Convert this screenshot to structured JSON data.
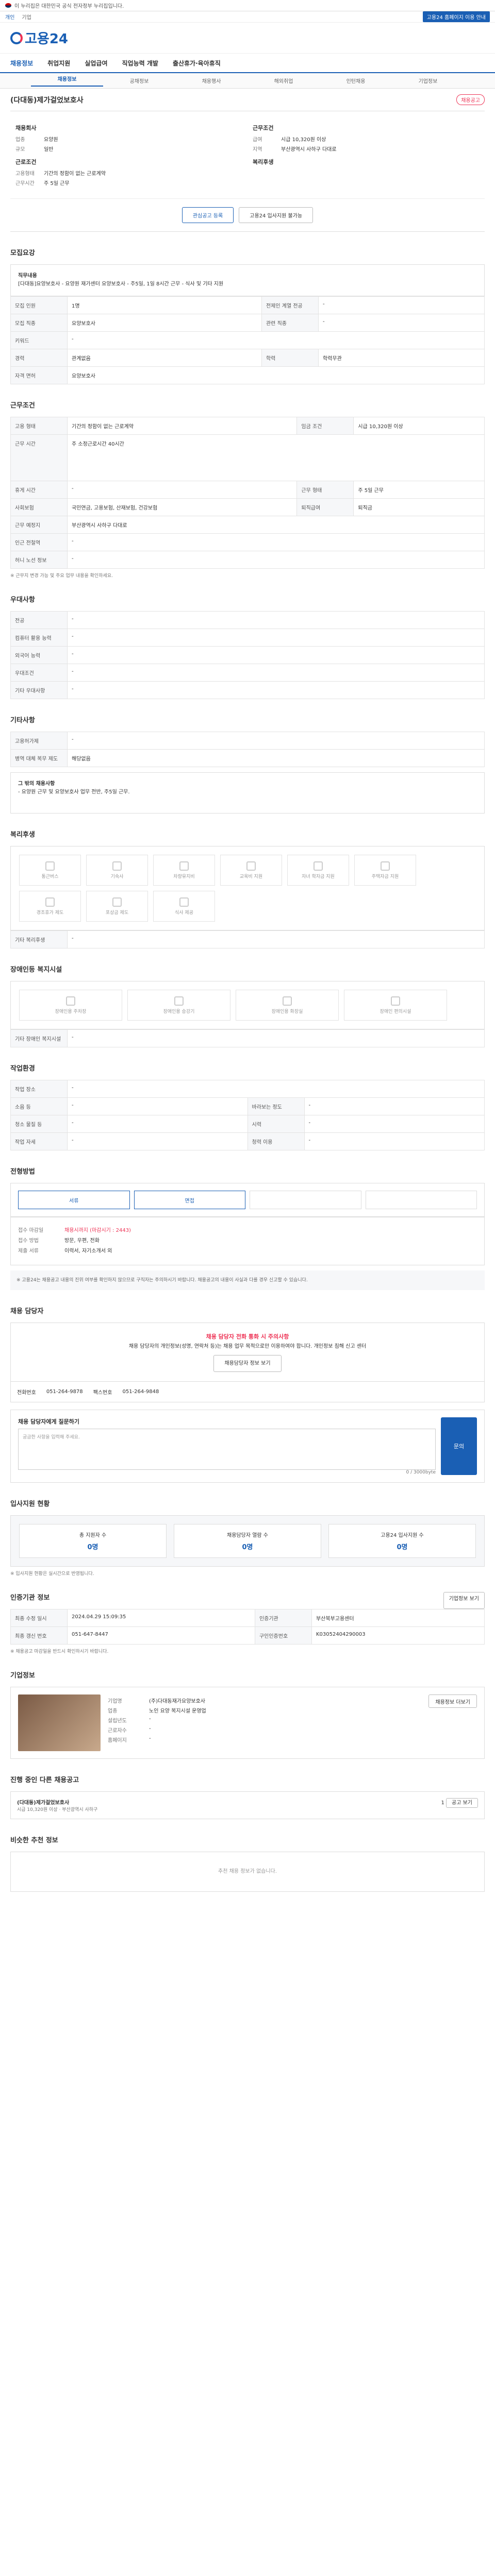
{
  "gov": {
    "text": "이 누리집은 대한민국 공식 전자정부 누리집입니다."
  },
  "top": {
    "home": "개인",
    "corp": "기업",
    "right": "고용24 홈페이지 이용 안내"
  },
  "logo": "고용24",
  "nav": [
    "채용정보",
    "취업지원",
    "실업급여",
    "직업능력 개발",
    "출산휴가·육아휴직"
  ],
  "subnav": [
    "채용정보",
    "공채정보",
    "채용행사",
    "해외취업",
    "인턴채용",
    "기업정보"
  ],
  "title": "(다대동)제가걸었보호사",
  "badge": "채용공고",
  "summary": {
    "left_h": "채용회사",
    "left": [
      [
        "업종",
        "요양원"
      ],
      [
        "규모",
        "일반"
      ]
    ],
    "left_h2": "근로조건",
    "left2": [
      [
        "고용형태",
        "기간의 정함이 없는 근로계약"
      ],
      [
        "근무시간",
        "주 5일 근무"
      ]
    ],
    "right_h": "근무조건",
    "right": [
      [
        "급여",
        "시급 10,320원 이상"
      ],
      [
        "지역",
        "부산광역시 사하구 다대로"
      ]
    ],
    "right_h2": "복리후생"
  },
  "buttons": {
    "apply": "관심공고 등록",
    "print": "고용24 입사지원 불가능"
  },
  "s1": {
    "h": "모집요강",
    "jobdesc_label": "직무내용",
    "jobdesc": "[다대동]요양보호사 - 요양원 재가센터 요양보호사 - 주5일, 1일 8시간 근무 - 식사 및 기타 지원",
    "rows": [
      [
        "모집 인원",
        "1명",
        "전제인 계열 전공",
        "-"
      ],
      [
        "모집 직종",
        "요양보호사",
        "관련 직종",
        "-"
      ],
      [
        "키워드",
        "-",
        "",
        ""
      ],
      [
        "경력",
        "관계없음",
        "학력",
        "학력무관"
      ],
      [
        "자격 면허",
        "요양보호사",
        "",
        ""
      ]
    ]
  },
  "s2": {
    "h": "근무조건",
    "rows": [
      [
        "고용 형태",
        "기간의 정함이 없는 근로계약",
        "임금 조건",
        "시급 10,320원 이상"
      ],
      [
        "근무 시간",
        "주 소정근로시간 40시간",
        "",
        ""
      ],
      [
        "휴게 시간",
        "-",
        "근무 형태",
        "주 5일 근무"
      ],
      [
        "사회보험",
        "국민연금, 고용보험, 산재보험, 건강보험",
        "퇴직급여",
        "퇴직금"
      ],
      [
        "근무 예정지",
        "부산광역시 사하구 다대로",
        "",
        ""
      ],
      [
        "인근 전철역",
        "-",
        "",
        ""
      ],
      [
        "허니 노선 정보",
        "-",
        "",
        ""
      ]
    ],
    "note": "※ 근무지 변경 가능 및 주요 업무 내용을 확인하세요."
  },
  "s3": {
    "h": "우대사항",
    "rows": [
      [
        "전공",
        "-"
      ],
      [
        "컴퓨터 활용 능력",
        "-"
      ],
      [
        "외국어 능력",
        "-"
      ],
      [
        "우대조건",
        "-"
      ],
      [
        "기타 우대사항",
        "-"
      ]
    ]
  },
  "s4": {
    "h": "기타사항",
    "rows": [
      [
        "고용허가제",
        "-"
      ],
      [
        "병역 대체 복무 제도",
        "해당없음"
      ]
    ],
    "extra_h": "그 밖의 채용사항",
    "extra": "- 요양원 근무 및 요양보호사 업무 전반, 주5일 근무."
  },
  "s5": {
    "h": "복리후생",
    "items": [
      "통근버스",
      "기숙사",
      "차량유지비",
      "교육비 지원",
      "자녀 학자금 지원",
      "주택자금 지원",
      "경조휴가 제도",
      "포상금 제도",
      "식사 제공"
    ],
    "other_label": "기타 복리후생",
    "other": "-"
  },
  "s6": {
    "h": "장애인등 복지시설",
    "items": [
      "장애인용 주차장",
      "장애인용 승강기",
      "장애인용 화장실",
      "장애인 편의시설"
    ],
    "other_label": "기타 장애인 복지시설",
    "other": "-"
  },
  "s7": {
    "h": "작업환경",
    "rows": [
      [
        "작업 장소",
        "-",
        "",
        ""
      ],
      [
        "소음 등",
        "-",
        "바라보는 정도",
        "-"
      ],
      [
        "청소 물질 등",
        "-",
        "시력",
        "-"
      ],
      [
        "작업 자세",
        "-",
        "청력 이용",
        "-"
      ]
    ]
  },
  "s8": {
    "h": "전형방법",
    "steps": [
      "서류",
      "면접",
      "",
      "",
      ""
    ],
    "rows": [
      [
        "접수 마감일",
        "채용시까지 (마감시기 : 2443)"
      ],
      [
        "접수 방법",
        "방문, 우편, 전화"
      ],
      [
        "제출 서류",
        "이력서, 자기소개서 외"
      ]
    ],
    "note": "※ 고용24는 채용공고 내용의 진위 여부를 확인하지 않으므로 구직자는 주의하시기 바랍니다. 채용공고의 내용이 사실과 다를 경우 신고할 수 있습니다."
  },
  "s9": {
    "h": "채용 담당자",
    "warn_t": "채용 담당자 전화 통화 시 주의사항",
    "warn": "채용 담당자의 개인정보(성명, 연락처 등)는 채용 업무 목적으로만 이용하여야 합니다. 개인정보 침해 신고 센터",
    "contact_btn": "채용담당자 정보 보기",
    "tel_label": "전화번호",
    "tel": "051-264-9878",
    "fax_label": "팩스번호",
    "fax": "051-264-9848",
    "q_h": "채용 담당자에게 질문하기",
    "q_ph": "궁금한 사항을 입력해 주세요.",
    "q_btn": "문의",
    "q_count": "0 / 3000byte"
  },
  "s10": {
    "h": "입사지원 현황",
    "stats": [
      [
        "총 지원자 수",
        "0명"
      ],
      [
        "채용담당자 열람 수",
        "0명"
      ],
      [
        "고용24 입사지원 수",
        "0명"
      ]
    ],
    "note": "※ 입사지원 현황은 실시간으로 반영됩니다."
  },
  "s11": {
    "h": "인증기관 정보",
    "btn": "기업정보 보기",
    "rows": [
      [
        "최종 수정 일시",
        "2024.04.29 15:09:35",
        "인증기관",
        "부산북부고용센터"
      ],
      [
        "최종 갱신 번호",
        "051-647-8447",
        "구인인증번호",
        "K03052404290003"
      ]
    ],
    "note": "※ 채용공고 마감일을 반드시 확인하시기 바랍니다."
  },
  "s12": {
    "h": "기업정보",
    "btn": "채용정보 더보기",
    "rows": [
      [
        "기업명",
        "(주)다대동재가요양보호사"
      ],
      [
        "업종",
        "노인 요양 복지시설 운영업"
      ],
      [
        "설립년도",
        "-"
      ],
      [
        "근로자수",
        "-"
      ],
      [
        "홈페이지",
        "-"
      ]
    ]
  },
  "s13": {
    "h": "진행 중인 다른 채용공고",
    "title": "(다대동)제가걸었보호사",
    "meta": "시급 10,320원 이상 · 부산광역시 사하구",
    "count": "1",
    "btn": "공고 보기"
  },
  "s14": {
    "h": "비슷한 추천 정보",
    "empty": "추천 채용 정보가 없습니다."
  }
}
